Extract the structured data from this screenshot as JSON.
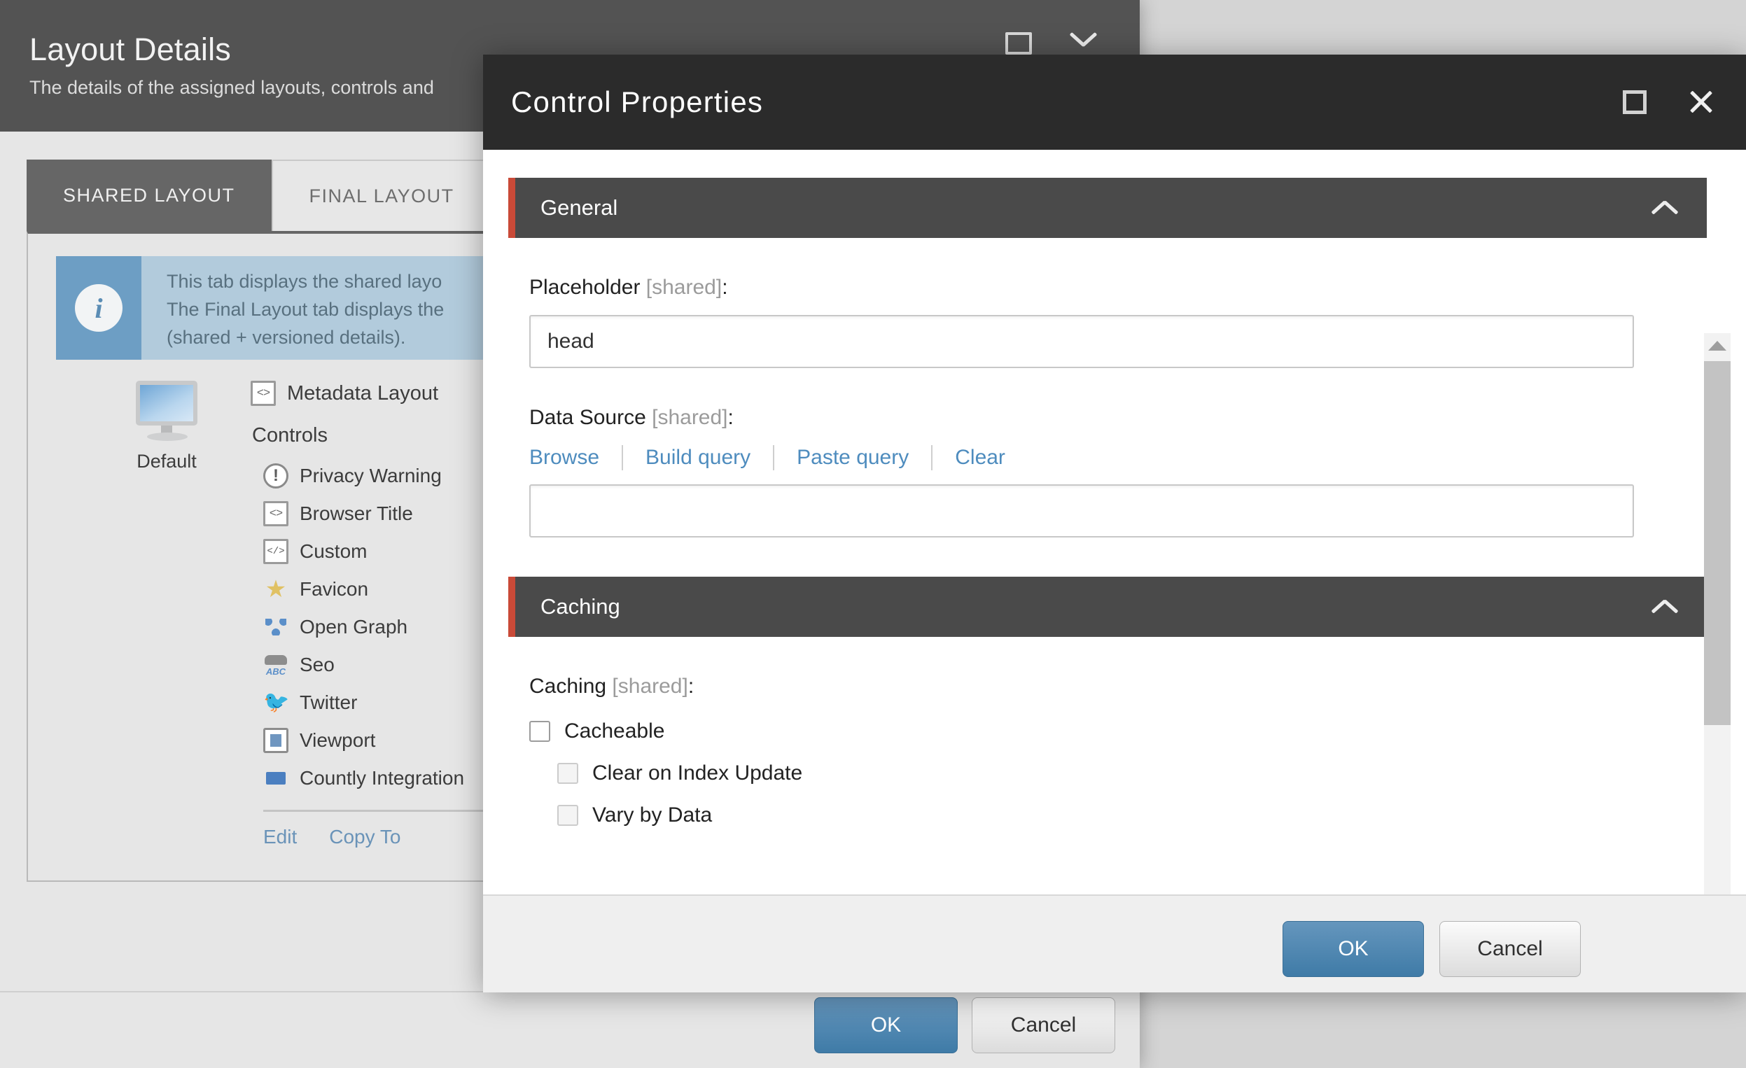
{
  "background_window": {
    "title": "Layout Details",
    "subtitle": "The details of the assigned layouts, controls and",
    "window_buttons": {
      "maximize": "maximize-icon",
      "minimize": "chevron-down-icon"
    },
    "tabs": [
      {
        "label": "SHARED LAYOUT",
        "active": true
      },
      {
        "label": "FINAL LAYOUT",
        "active": false
      }
    ],
    "info_box": {
      "icon": "info-icon",
      "lines": [
        "This tab displays the shared layo",
        "The Final Layout tab displays the",
        "(shared + versioned details)."
      ]
    },
    "layout_card": {
      "thumbnail_icon": "monitor-icon",
      "thumbnail_label": "Default",
      "metadata_layout": {
        "icon": "code-file-icon",
        "label": "Metadata Layout"
      },
      "controls_heading": "Controls",
      "controls": [
        {
          "icon": "warning-icon",
          "label": "Privacy Warning"
        },
        {
          "icon": "code-file-icon",
          "label": "Browser Title"
        },
        {
          "icon": "custom-code-icon",
          "label": "Custom"
        },
        {
          "icon": "star-icon",
          "label": "Favicon"
        },
        {
          "icon": "open-graph-icon",
          "label": "Open Graph"
        },
        {
          "icon": "seo-icon",
          "label": "Seo"
        },
        {
          "icon": "twitter-bird-icon",
          "label": "Twitter"
        },
        {
          "icon": "viewport-icon",
          "label": "Viewport"
        },
        {
          "icon": "countly-icon",
          "label": "Countly Integration"
        }
      ],
      "links": [
        {
          "label": "Edit"
        },
        {
          "label": "Copy To"
        }
      ]
    },
    "footer": {
      "ok_label": "OK",
      "cancel_label": "Cancel"
    }
  },
  "dialog": {
    "title": "Control Properties",
    "window_buttons": {
      "maximize": "maximize-icon",
      "close": "close-icon"
    },
    "sections": [
      {
        "id": "general",
        "title": "General",
        "collapse_icon": "chevron-up-icon",
        "accent_color": "#c94a38",
        "fields": {
          "placeholder": {
            "label": "Placeholder",
            "shared_tag": "[shared]",
            "suffix": ":",
            "value": "head",
            "placeholder_text": ""
          },
          "data_source": {
            "label": "Data Source",
            "shared_tag": "[shared]",
            "suffix": ":",
            "value": "",
            "placeholder_text": "",
            "actions": [
              "Browse",
              "Build query",
              "Paste query",
              "Clear"
            ]
          }
        }
      },
      {
        "id": "caching",
        "title": "Caching",
        "collapse_icon": "chevron-up-icon",
        "accent_color": "#c94a38",
        "fields": {
          "caching": {
            "label": "Caching",
            "shared_tag": "[shared]",
            "suffix": ":",
            "checkboxes": [
              {
                "label": "Cacheable",
                "checked": false,
                "indent": 0
              },
              {
                "label": "Clear on Index Update",
                "checked": false,
                "indent": 1
              },
              {
                "label": "Vary by Data",
                "checked": false,
                "indent": 1
              }
            ]
          }
        }
      }
    ],
    "scrollbar": {
      "up_icon": "scroll-up-arrow-icon",
      "down_icon": "scroll-down-arrow-icon",
      "indicator_color": "#8fbba6"
    },
    "footer": {
      "ok_label": "OK",
      "cancel_label": "Cancel"
    }
  }
}
